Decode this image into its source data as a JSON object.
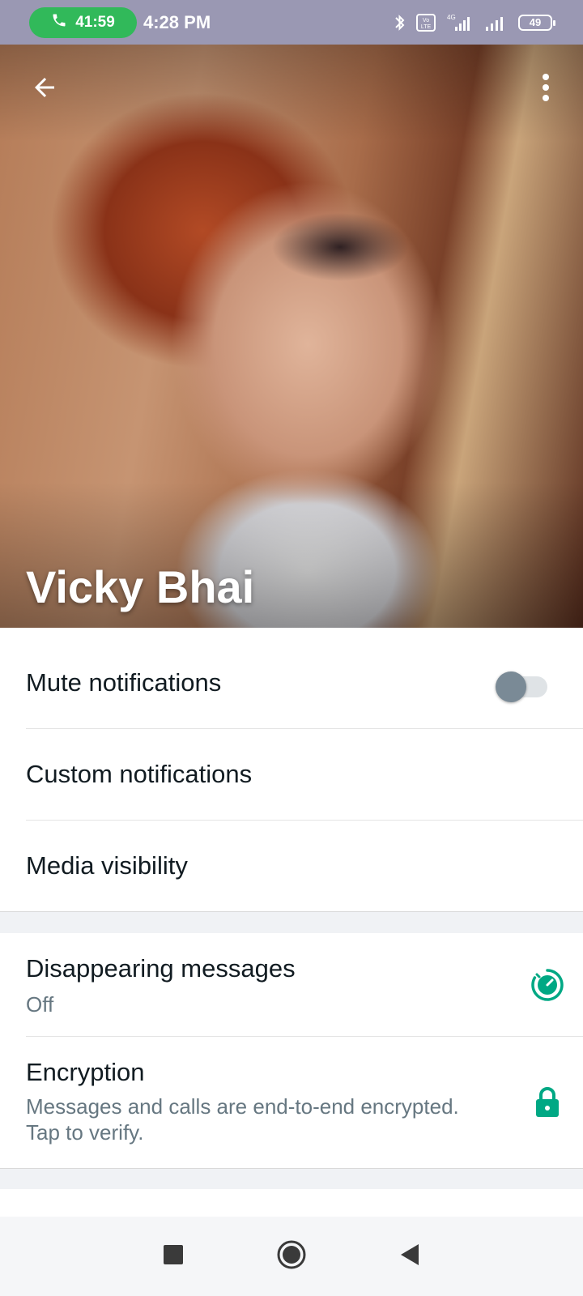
{
  "status_bar": {
    "call_timer": "41:59",
    "time": "4:28 PM",
    "network_label": "4G",
    "volte_label": "Vo LTE",
    "battery_level": "49",
    "icons": [
      "phone-icon",
      "bluetooth-icon",
      "volte-icon",
      "signal-icon",
      "signal-icon",
      "battery-icon"
    ]
  },
  "profile": {
    "name": "Vicky Bhai",
    "icons": {
      "back": "arrow-left-icon",
      "menu": "more-vertical-icon"
    }
  },
  "settings": {
    "mute_notifications": {
      "label": "Mute notifications",
      "enabled": false
    },
    "custom_notifications": {
      "label": "Custom notifications"
    },
    "media_visibility": {
      "label": "Media visibility"
    },
    "disappearing_messages": {
      "label": "Disappearing messages",
      "value": "Off",
      "icon": "timer-icon"
    },
    "encryption": {
      "label": "Encryption",
      "description": "Messages and calls are end-to-end encrypted. Tap to verify.",
      "icon": "lock-icon"
    }
  },
  "nav_bar": {
    "icons": [
      "recent-apps-icon",
      "home-icon",
      "back-icon"
    ]
  },
  "colors": {
    "accent": "#00a884",
    "call_pill": "#31b95a",
    "status_bar": "#9a98b3",
    "secondary_text": "#667781"
  }
}
